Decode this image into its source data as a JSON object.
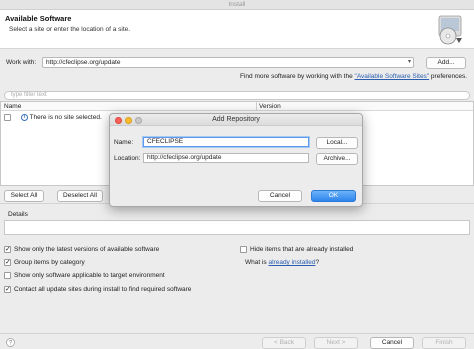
{
  "window": {
    "title": "Install"
  },
  "header": {
    "title": "Available Software",
    "subtitle": "Select a site or enter the location of a site.",
    "icon": "cd-install-icon"
  },
  "work_with": {
    "label": "Work with:",
    "value": "http://cfeclipse.org/update",
    "add_label": "Add...",
    "more_prefix": "Find more software by working with the ",
    "more_link": "\"Available Software Sites\"",
    "more_suffix": " preferences."
  },
  "filter": {
    "placeholder": "type filter text"
  },
  "table": {
    "columns": [
      "Name",
      "Version"
    ],
    "rows": [
      {
        "name": "There is no site selected.",
        "version": ""
      }
    ]
  },
  "selection": {
    "select_all": "Select All",
    "deselect_all": "Deselect All"
  },
  "details": {
    "label": "Details"
  },
  "options_left": [
    {
      "label": "Show only the latest versions of available software",
      "checked": true
    },
    {
      "label": "Group items by category",
      "checked": true
    },
    {
      "label": "Show only software applicable to target environment",
      "checked": false
    },
    {
      "label": "Contact all update sites during install to find required software",
      "checked": true
    }
  ],
  "options_right": {
    "hide_installed": {
      "label": "Hide items that are already installed",
      "checked": false
    },
    "what_is_prefix": "What is ",
    "what_is_link": "already installed",
    "what_is_suffix": "?"
  },
  "footer": {
    "back": "< Back",
    "next": "Next >",
    "cancel": "Cancel",
    "finish": "Finish"
  },
  "dialog": {
    "title": "Add Repository",
    "name_label": "Name:",
    "name_value": "CFECLIPSE",
    "local_button": "Local...",
    "location_label": "Location:",
    "location_value": "http://cfeclipse.org/update",
    "archive_button": "Archive...",
    "cancel_button": "Cancel",
    "ok_button": "OK",
    "colors": {
      "primary": "#2d85ec",
      "close": "#fc5f57",
      "minimize": "#fdbc2e",
      "zoom": "#c8c8c8"
    }
  }
}
